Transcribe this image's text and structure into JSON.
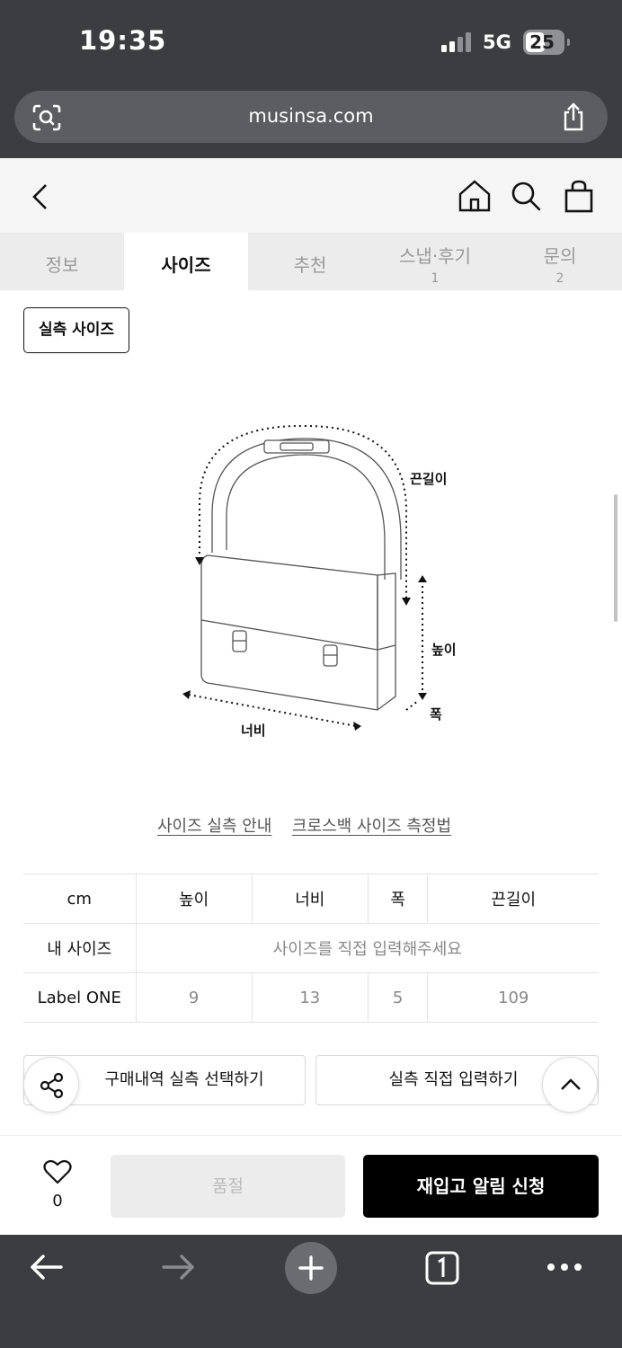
{
  "status_bar": {
    "time": "19:35",
    "network": "5G",
    "battery": "25"
  },
  "browser": {
    "url": "musinsa.com"
  },
  "tabs": [
    {
      "label": "정보",
      "count": ""
    },
    {
      "label": "사이즈",
      "count": ""
    },
    {
      "label": "추천",
      "count": ""
    },
    {
      "label": "스냅·후기",
      "count": "1"
    },
    {
      "label": "문의",
      "count": "2"
    }
  ],
  "active_tab": "사이즈",
  "measure_chip": "실측 사이즈",
  "diagram": {
    "strap": "끈길이",
    "height": "높이",
    "width": "너비",
    "depth": "폭"
  },
  "links": {
    "guide": "사이즈 실측 안내",
    "method": "크로스백 사이즈 측정법"
  },
  "size_table": {
    "unit": "cm",
    "headers": [
      "높이",
      "너비",
      "폭",
      "끈길이"
    ],
    "my_size_label": "내 사이즈",
    "my_size_placeholder": "사이즈를 직접 입력해주세요",
    "rows": [
      {
        "label": "Label ONE",
        "values": [
          "9",
          "13",
          "5",
          "109"
        ]
      }
    ]
  },
  "buttons": {
    "purchase_history": "구매내역 실측 선택하기",
    "direct_input": "실측 직접 입력하기"
  },
  "buy_bar": {
    "like_count": "0",
    "sold_out": "품절",
    "restock": "재입고 알림 신청"
  }
}
